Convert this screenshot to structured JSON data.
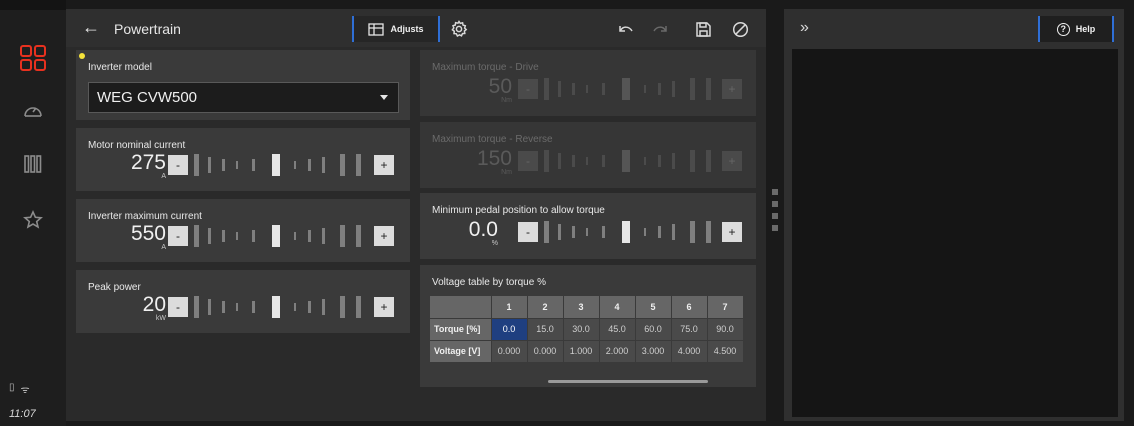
{
  "header": {
    "title": "Powertrain",
    "adjusts_tab": "Adjusts"
  },
  "status": {
    "time": "11:07"
  },
  "inverter_model": {
    "label": "Inverter model",
    "value": "WEG CVW500"
  },
  "motor_current": {
    "label": "Motor nominal current",
    "value": "275",
    "unit": "A"
  },
  "inverter_max_current": {
    "label": "Inverter maximum current",
    "value": "550",
    "unit": "A"
  },
  "peak_power": {
    "label": "Peak power",
    "value": "20",
    "unit": "kW"
  },
  "max_torque_drive": {
    "label": "Maximum torque - Drive",
    "value": "50",
    "unit": "Nm",
    "enabled": false
  },
  "max_torque_reverse": {
    "label": "Maximum torque - Reverse",
    "value": "150",
    "unit": "Nm",
    "enabled": false
  },
  "min_pedal": {
    "label": "Minimum pedal position to allow torque",
    "value": "0.0",
    "unit": "%"
  },
  "stepper_buttons": {
    "minus": "-",
    "plus": "+"
  },
  "voltage_table": {
    "title": "Voltage table by torque %",
    "columns": [
      "1",
      "2",
      "3",
      "4",
      "5",
      "6",
      "7"
    ],
    "rows": [
      {
        "label": "Torque [%]",
        "cells": [
          "0.0",
          "15.0",
          "30.0",
          "45.0",
          "60.0",
          "75.0",
          "90.0"
        ]
      },
      {
        "label": "Voltage [V]",
        "cells": [
          "0.000",
          "0.000",
          "1.000",
          "2.000",
          "3.000",
          "4.000",
          "4.500"
        ]
      }
    ],
    "selected_cell": "0.0"
  },
  "help_button": "Help",
  "colors": {
    "accent_blue": "#2f6fd6",
    "active_red": "#e8311f",
    "indicator_yellow": "#f5e33a",
    "selected_cell": "#1f3f80"
  }
}
